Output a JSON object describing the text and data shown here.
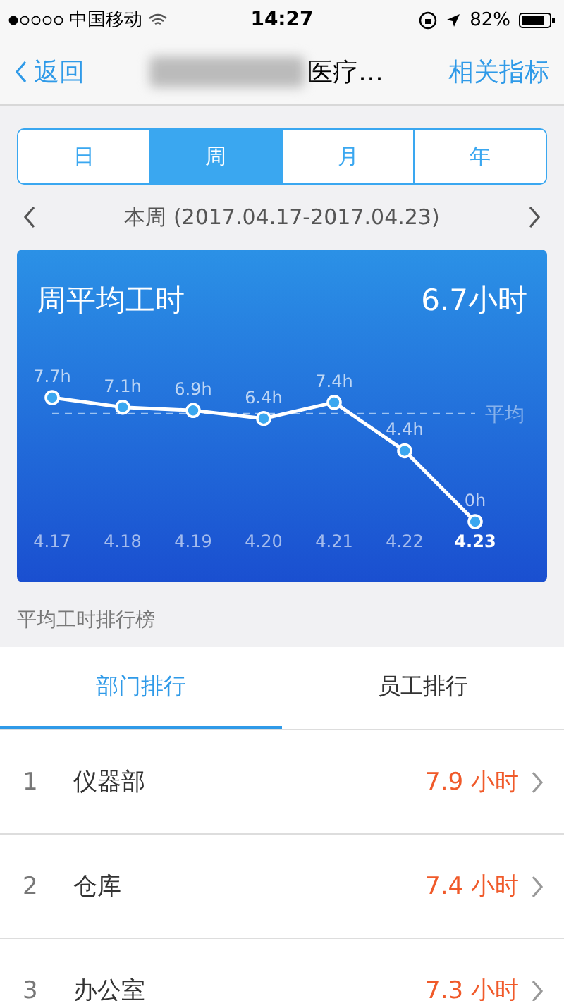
{
  "status_bar": {
    "carrier": "中国移动",
    "time": "14:27",
    "battery": "82%"
  },
  "nav": {
    "back": "返回",
    "title": "医疗…",
    "action": "相关指标"
  },
  "periods": [
    {
      "label": "日",
      "selected": false
    },
    {
      "label": "周",
      "selected": true
    },
    {
      "label": "月",
      "selected": false
    },
    {
      "label": "年",
      "selected": false
    }
  ],
  "range": {
    "label": "本周 (2017.04.17-2017.04.23)"
  },
  "summary": {
    "title": "周平均工时",
    "value": "6.7小时",
    "chart_data": {
      "type": "line",
      "categories": [
        "4.17",
        "4.18",
        "4.19",
        "4.20",
        "4.21",
        "4.22",
        "4.23"
      ],
      "ylabel": "h",
      "data_labels": true,
      "series": [
        {
          "color": "#ffffff",
          "marker": true,
          "values": [
            7.7,
            7.1,
            6.9,
            6.4,
            7.4,
            4.4,
            0
          ]
        }
      ]
    },
    "average_label": "平均",
    "days": [
      {
        "selected": false
      },
      {
        "selected": false
      },
      {
        "selected": false
      },
      {
        "selected": false
      },
      {
        "selected": false
      },
      {
        "selected": false
      },
      {
        "selected": true
      }
    ]
  },
  "ranking": {
    "title": "平均工时排行榜",
    "tabs": [
      {
        "label": "部门排行",
        "selected": true
      },
      {
        "label": "员工排行",
        "selected": false
      }
    ],
    "rows": [
      {
        "rank": "1",
        "name": "仪器部",
        "value": "7.9 小时"
      },
      {
        "rank": "2",
        "name": "仓库",
        "value": "7.4 小时"
      },
      {
        "rank": "3",
        "name": "办公室",
        "value": "7.3 小时"
      }
    ]
  }
}
